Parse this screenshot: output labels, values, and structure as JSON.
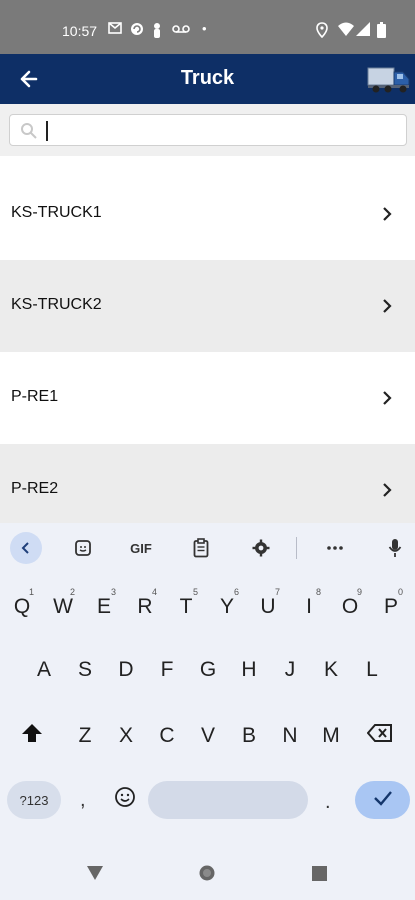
{
  "status_bar": {
    "time": "10:57",
    "left_icons": [
      "gmail-icon",
      "sync-icon",
      "person-icon",
      "voicemail-icon",
      "dot-icon"
    ],
    "right_icons": [
      "location-icon",
      "wifi-icon",
      "signal-icon",
      "battery-icon"
    ]
  },
  "app_bar": {
    "title": "Truck",
    "back_icon": "back-arrow-icon",
    "logo_icon": "truck-icon"
  },
  "search": {
    "value": "",
    "placeholder": "",
    "icon": "search-icon"
  },
  "list": {
    "items": [
      {
        "label": "KS-TRUCK1"
      },
      {
        "label": "KS-TRUCK2"
      },
      {
        "label": "P-RE1"
      },
      {
        "label": "P-RE2"
      }
    ]
  },
  "keyboard": {
    "toolbar": {
      "gif_label": "GIF",
      "icons": [
        "chevron-left-icon",
        "sticker-icon",
        "gif-icon",
        "clipboard-icon",
        "settings-icon",
        "more-icon",
        "mic-icon"
      ]
    },
    "row1": [
      "Q",
      "W",
      "E",
      "R",
      "T",
      "Y",
      "U",
      "I",
      "O",
      "P"
    ],
    "row1_sup": [
      "1",
      "2",
      "3",
      "4",
      "5",
      "6",
      "7",
      "8",
      "9",
      "0"
    ],
    "row2": [
      "A",
      "S",
      "D",
      "F",
      "G",
      "H",
      "J",
      "K",
      "L"
    ],
    "row3": [
      "Z",
      "X",
      "C",
      "V",
      "B",
      "N",
      "M"
    ],
    "symbols_label": "?123",
    "comma": ",",
    "period": ".",
    "colors": {
      "background": "#eef1f8",
      "accent": "#a9c6f3"
    }
  },
  "nav_bar": {
    "icons": [
      "back-triangle-icon",
      "home-circle-icon",
      "recents-square-icon"
    ]
  },
  "colors": {
    "app_bar": "#0e2f66",
    "status_bar": "#7a7a7a",
    "row_alt": "#ececec"
  }
}
